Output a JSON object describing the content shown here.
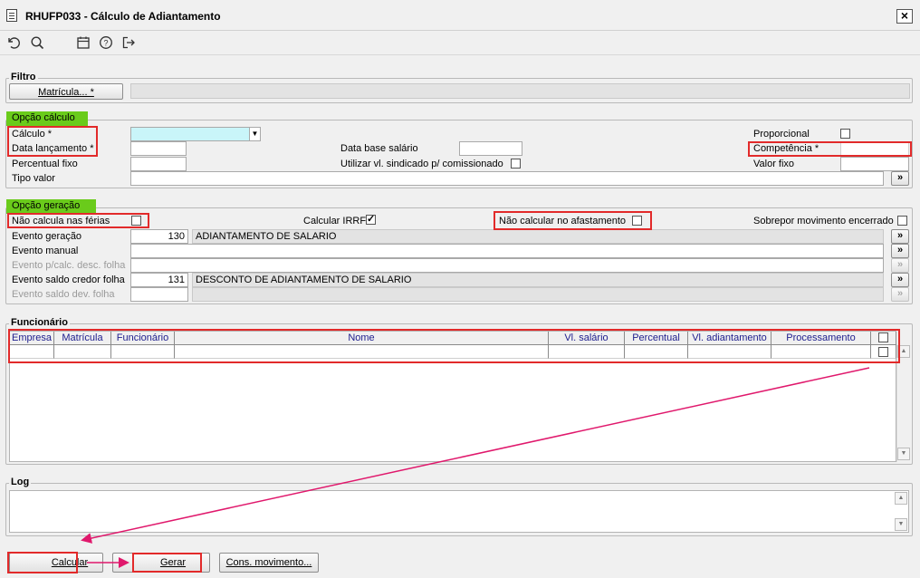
{
  "window": {
    "title": "RHUFP033 - Cálculo de Adiantamento",
    "close": "×"
  },
  "toolbar": {
    "icons": [
      "undo-icon",
      "search-icon",
      "calendar-icon",
      "help-icon",
      "exit-icon"
    ]
  },
  "filtro": {
    "legend": "Filtro",
    "matricula_button": "Matrícula... *",
    "matricula_value": ""
  },
  "opcao_calculo": {
    "legend": "Opção cálculo",
    "calculo_label": "Cálculo *",
    "calculo_value": "",
    "data_lancamento_label": "Data lançamento *",
    "data_lancamento_value": "",
    "percentual_fixo_label": "Percentual fixo",
    "percentual_fixo_value": "",
    "tipo_valor_label": "Tipo valor",
    "tipo_valor_value": "",
    "data_base_salario_label": "Data base salário",
    "data_base_salario_value": "",
    "utilizar_label": "Utilizar vl. sindicado p/ comissionado",
    "utilizar_checked": false,
    "proporcional_label": "Proporcional",
    "proporcional_checked": false,
    "competencia_label": "Competência *",
    "competencia_value": "",
    "valor_fixo_label": "Valor fixo",
    "valor_fixo_value": "",
    "lookup_label": "»"
  },
  "opcao_geracao": {
    "legend": "Opção geração",
    "nao_calcula_ferias_label": "Não calcula nas férias",
    "nao_calcula_ferias_checked": false,
    "calcular_irrf_label": "Calcular IRRF",
    "calcular_irrf_checked": true,
    "nao_calcular_afastamento_label": "Não calcular no afastamento",
    "nao_calcular_afastamento_checked": false,
    "sobrepor_label": "Sobrepor movimento encerrado",
    "sobrepor_checked": false,
    "evento_geracao_label": "Evento geração",
    "evento_geracao_code": "130",
    "evento_geracao_desc": "ADIANTAMENTO DE SALARIO",
    "evento_manual_label": "Evento manual",
    "evento_manual_value": "",
    "evento_pcalc_label": "Evento p/calc. desc. folha",
    "evento_pcalc_value": "",
    "evento_saldo_credor_label": "Evento saldo credor folha",
    "evento_saldo_credor_code": "131",
    "evento_saldo_credor_desc": "DESCONTO DE ADIANTAMENTO DE SALARIO",
    "evento_saldo_dev_label": "Evento saldo dev. folha",
    "evento_saldo_dev_value": "",
    "lookup_label": "»"
  },
  "funcionario": {
    "legend": "Funcionário",
    "columns": [
      "Empresa",
      "Matrícula",
      "Funcionário",
      "Nome",
      "Vl. salário",
      "Percentual",
      "Vl. adiantamento",
      "Processamento"
    ]
  },
  "log": {
    "legend": "Log",
    "value": ""
  },
  "buttons": {
    "calcular": "Calcular",
    "gerar": "Gerar",
    "cons_movimento": "Cons. movimento..."
  },
  "colors": {
    "highlight_green": "#6acb1b",
    "annotation_red": "#e22a2a",
    "arrow_pink": "#e0186c",
    "cyan_field": "#c9f5f9"
  }
}
